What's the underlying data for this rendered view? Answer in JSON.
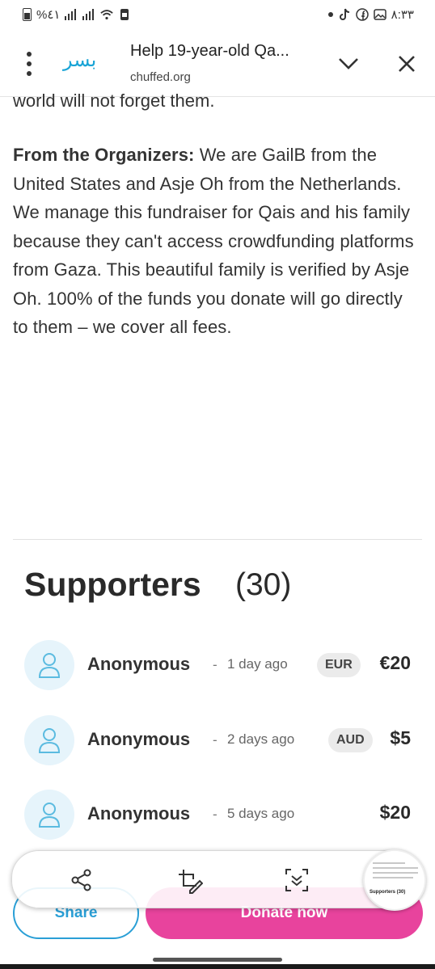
{
  "status_bar": {
    "left_text": "%٤١",
    "clock": "٨:٣٣"
  },
  "toolbar": {
    "logo_text": "بسر",
    "tab_title": "Help 19-year-old Qa...",
    "url": "chuffed.org"
  },
  "article": {
    "clipped_line": "world will not forget them.",
    "organizers_label": "From the Organizers:",
    "organizers_text": " We are GailB from the United States and Asje Oh from the Netherlands. We manage this fundraiser for Qais and his family because they can't access crowdfunding platforms from Gaza. This beautiful family is verified by Asje Oh. 100% of the funds you donate will go directly to them – we cover all fees."
  },
  "supporters": {
    "title": "Supporters",
    "count": "(30)",
    "list": [
      {
        "name": "Anonymous",
        "sep": "-",
        "time": "1 day ago",
        "currency": "EUR",
        "amount": "€20"
      },
      {
        "name": "Anonymous",
        "sep": "-",
        "time": "2 days ago",
        "currency": "AUD",
        "amount": "$5"
      },
      {
        "name": "Anonymous",
        "sep": "-",
        "time": "5 days ago",
        "currency": "",
        "amount": "$20"
      }
    ]
  },
  "buttons": {
    "share": "Share",
    "donate": "Donate now"
  },
  "overlay": {
    "thumbnail_label": "Supporters (30)"
  },
  "colors": {
    "brand_blue": "#2a9fd6",
    "donate_pink": "#e8439d",
    "avatar_bg": "#e6f4fb"
  }
}
